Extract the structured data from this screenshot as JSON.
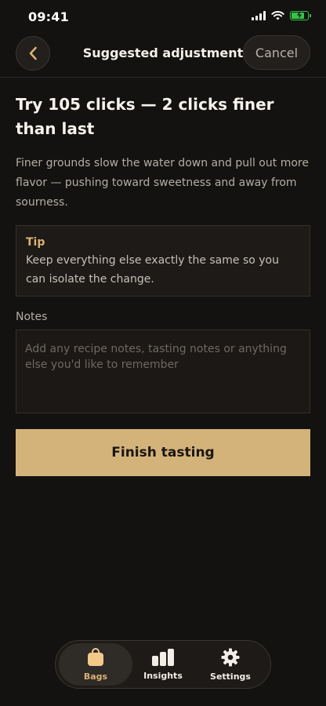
{
  "status_bar": {
    "time": "09:41"
  },
  "nav": {
    "title": "Suggested adjustment",
    "cancel_label": "Cancel"
  },
  "suggestion": {
    "heading": "Try 105 clicks — 2 clicks finer than last",
    "description": "Finer grounds slow the water down and pull out more flavor — pushing toward sweetness and away from sourness."
  },
  "tip": {
    "title": "Tip",
    "body": "Keep everything else exactly the same so you can isolate the change."
  },
  "notes": {
    "label": "Notes",
    "placeholder": "Add any recipe notes, tasting notes or anything else you'd like to remember",
    "value": ""
  },
  "primary_action": {
    "label": "Finish tasting"
  },
  "tabbar": {
    "items": [
      {
        "label": "Bags",
        "icon": "bag-icon",
        "active": true
      },
      {
        "label": "Insights",
        "icon": "bar-chart-icon",
        "active": false
      },
      {
        "label": "Settings",
        "icon": "gear-icon",
        "active": false
      }
    ]
  },
  "colors": {
    "accent": "#d4b37b",
    "tip_title": "#d9b273",
    "background": "#141210",
    "battery": "#36c24a"
  }
}
